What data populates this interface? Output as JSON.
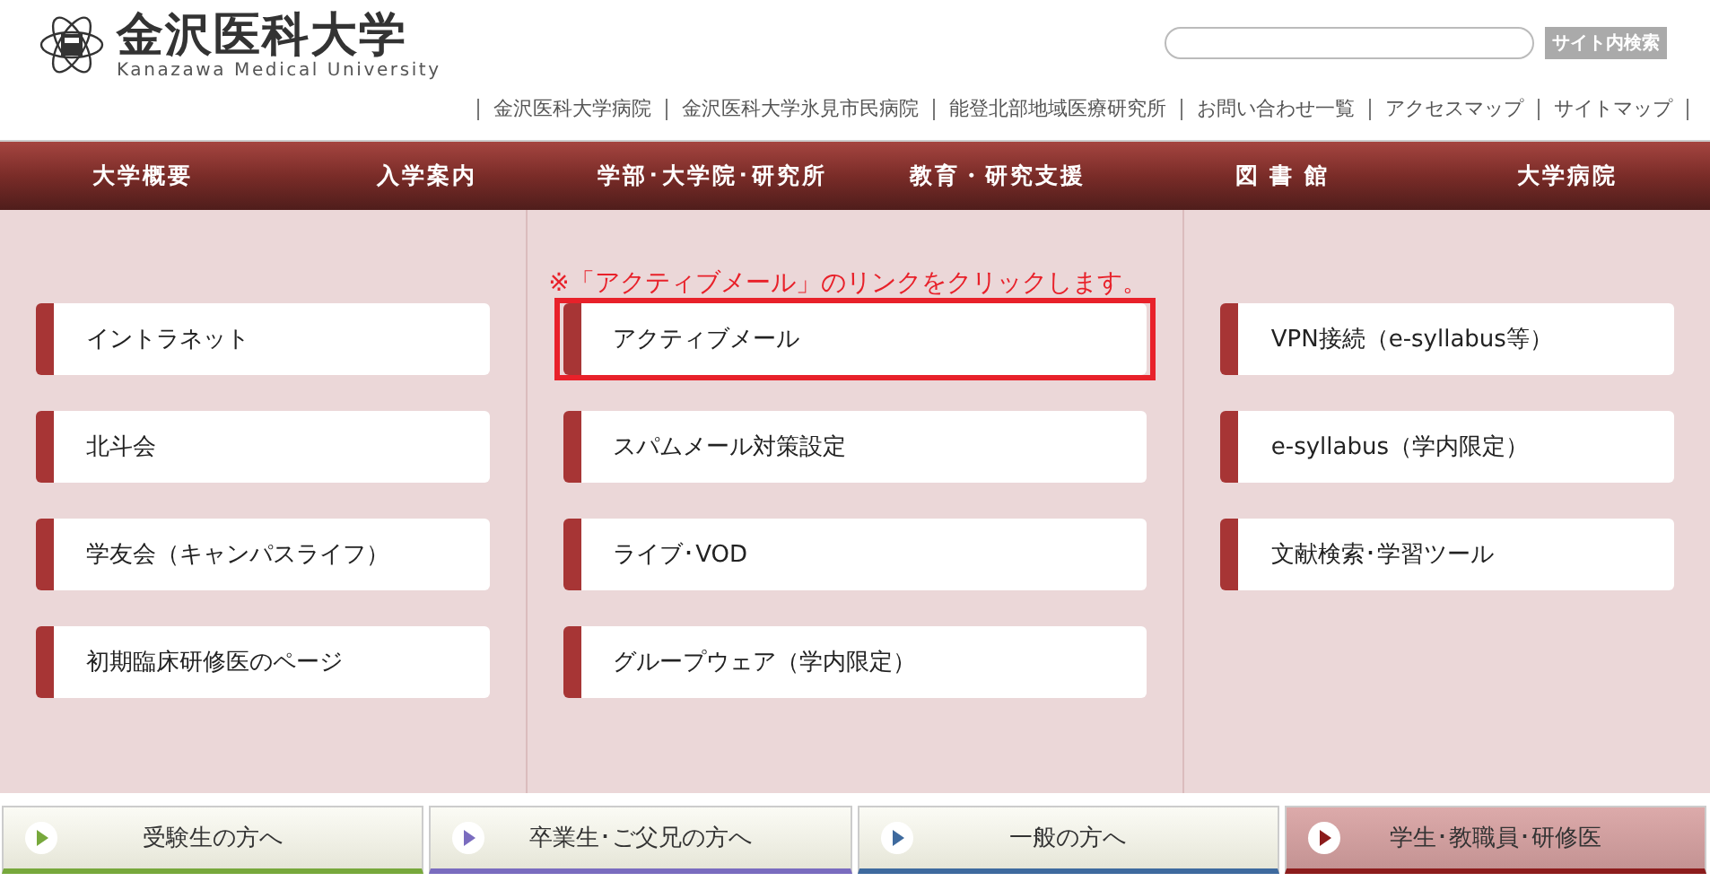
{
  "logo": {
    "title": "金沢医科大学",
    "subtitle": "Kanazawa Medical University"
  },
  "search": {
    "button": "サイト内検索"
  },
  "utility_links": [
    "金沢医科大学病院",
    "金沢医科大学氷見市民病院",
    "能登北部地域医療研究所",
    "お問い合わせ一覧",
    "アクセスマップ",
    "サイトマップ"
  ],
  "nav": [
    "大学概要",
    "入学案内",
    "学部･大学院･研究所",
    "教育・研究支援",
    "図 書 館",
    "大学病院"
  ],
  "notice": "※「アクティブメール」のリンクをクリックします。",
  "columns": [
    {
      "links": [
        {
          "label": "イントラネット",
          "highlighted": false
        },
        {
          "label": "北斗会",
          "highlighted": false
        },
        {
          "label": "学友会（キャンパスライフ）",
          "highlighted": false
        },
        {
          "label": "初期臨床研修医のページ",
          "highlighted": false
        }
      ]
    },
    {
      "links": [
        {
          "label": "アクティブメール",
          "highlighted": true
        },
        {
          "label": "スパムメール対策設定",
          "highlighted": false
        },
        {
          "label": "ライブ･VOD",
          "highlighted": false
        },
        {
          "label": "グループウェア（学内限定）",
          "highlighted": false
        }
      ]
    },
    {
      "links": [
        {
          "label": "VPN接続（e-syllabus等）",
          "highlighted": false
        },
        {
          "label": "e-syllabus（学内限定）",
          "highlighted": false
        },
        {
          "label": "文献検索･学習ツール",
          "highlighted": false
        }
      ]
    }
  ],
  "audience_tabs": [
    {
      "label": "受験生の方へ",
      "color": "#77a83c",
      "selected": false
    },
    {
      "label": "卒業生･ご父兄の方へ",
      "color": "#7a6cbf",
      "selected": false
    },
    {
      "label": "一般の方へ",
      "color": "#3e6a9e",
      "selected": false
    },
    {
      "label": "学生･教職員･研修医",
      "color": "#8c1c1c",
      "selected": true
    }
  ]
}
